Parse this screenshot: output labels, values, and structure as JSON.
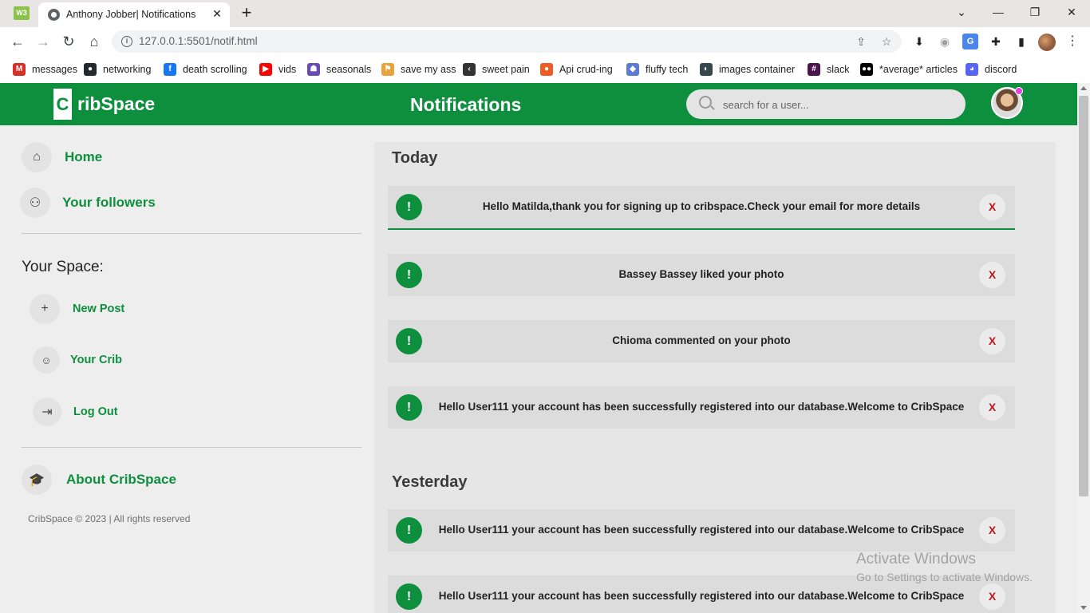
{
  "browser": {
    "app_badge": "W3",
    "tab_title": "Anthony Jobber| Notifications",
    "tab_close": "✕",
    "new_tab": "+",
    "url": "127.0.0.1:5501/notif.html",
    "window_controls": {
      "chevron": "⌄",
      "minimize": "—",
      "restore": "❐",
      "close": "✕"
    },
    "bookmarks": [
      {
        "label": "messages",
        "icon": "gmail-icon",
        "color": "#d93025"
      },
      {
        "label": "networking",
        "icon": "github-icon",
        "color": "#24292e"
      },
      {
        "label": "death scrolling",
        "icon": "facebook-icon",
        "color": "#1877f2"
      },
      {
        "label": "vids",
        "icon": "youtube-icon",
        "color": "#ff0000"
      },
      {
        "label": "seasonals",
        "icon": "seasonals-icon",
        "color": "#6a4bb5"
      },
      {
        "label": "save my ass",
        "icon": "save-icon",
        "color": "#e8a33d"
      },
      {
        "label": "sweet pain",
        "icon": "codewars-icon",
        "color": "#333333"
      },
      {
        "label": "Api crud-ing",
        "icon": "postman-icon",
        "color": "#ef5b25"
      },
      {
        "label": "fluffy tech",
        "icon": "fluffy-tech-icon",
        "color": "#5b7bd5"
      },
      {
        "label": "images container",
        "icon": "images-icon",
        "color": "#37474f"
      },
      {
        "label": "slack",
        "icon": "slack-icon",
        "color": "#4a154b"
      },
      {
        "label": "*average* articles",
        "icon": "medium-icon",
        "color": "#000000"
      },
      {
        "label": "discord",
        "icon": "discord-icon",
        "color": "#5865f2"
      }
    ]
  },
  "header": {
    "logo_letter": "C",
    "logo_text": "ribSpace",
    "title": "Notifications",
    "search_placeholder": "search for a user...",
    "brand_color": "#0d8f3e"
  },
  "sidebar": {
    "home": "Home",
    "followers": "Your followers",
    "space_heading": "Your Space:",
    "new_post": "New Post",
    "new_post_icon": "+",
    "your_crib": "Your Crib",
    "log_out": "Log Out",
    "about": "About CribSpace",
    "copyright": "CribSpace © 2023 | All rights reserved"
  },
  "notifications": {
    "today_title": "Today",
    "yesterday_title": "Yesterday",
    "icon_glyph": "!",
    "close_glyph": "X",
    "today": [
      "Hello Matilda,thank you for signing up to cribspace.Check your email for more details",
      "Bassey Bassey liked your photo",
      "Chioma commented on your photo",
      "Hello User111 your account has been successfully registered into our database.Welcome to CribSpace"
    ],
    "yesterday": [
      "Hello User111 your account has been successfully registered into our database.Welcome to CribSpace",
      "Hello User111 your account has been successfully registered into our database.Welcome to CribSpace"
    ]
  },
  "watermark": {
    "title": "Activate Windows",
    "subtitle": "Go to Settings to activate Windows."
  }
}
